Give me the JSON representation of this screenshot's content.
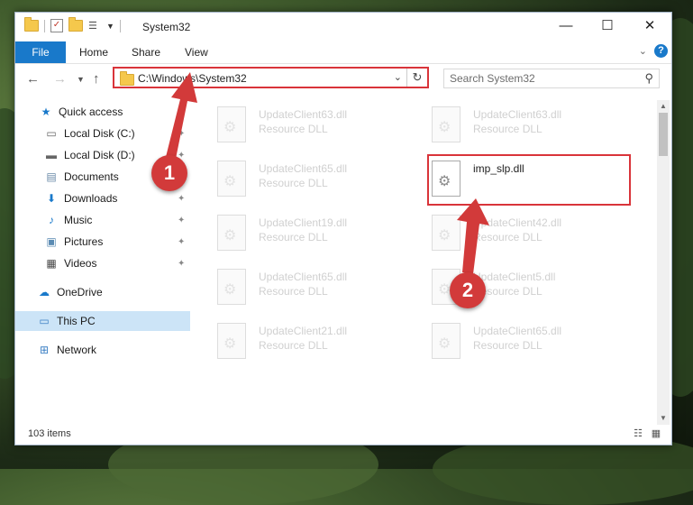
{
  "window": {
    "title": "System32"
  },
  "ribbon": {
    "tabs": [
      "File",
      "Home",
      "Share",
      "View"
    ]
  },
  "address": {
    "path": "C:\\Windows\\System32"
  },
  "search": {
    "placeholder": "Search System32"
  },
  "sidebar": {
    "items": [
      {
        "label": "Quick access",
        "icon": "star-icon",
        "pinned": false
      },
      {
        "label": "Local Disk (C:)",
        "icon": "drive-icon",
        "pinned": true
      },
      {
        "label": "Local Disk (D:)",
        "icon": "drive-icon",
        "pinned": true
      },
      {
        "label": "Documents",
        "icon": "documents-icon",
        "pinned": true
      },
      {
        "label": "Downloads",
        "icon": "downloads-icon",
        "pinned": true
      },
      {
        "label": "Music",
        "icon": "music-icon",
        "pinned": true
      },
      {
        "label": "Pictures",
        "icon": "pictures-icon",
        "pinned": true
      },
      {
        "label": "Videos",
        "icon": "videos-icon",
        "pinned": true
      },
      {
        "label": "OneDrive",
        "icon": "cloud-icon",
        "pinned": false
      },
      {
        "label": "This PC",
        "icon": "computer-icon",
        "pinned": false,
        "selected": true
      },
      {
        "label": "Network",
        "icon": "network-icon",
        "pinned": false
      }
    ]
  },
  "files": [
    {
      "name": "UpdateClient63.dll",
      "type": "Resource DLL"
    },
    {
      "name": "UpdateClient63.dll",
      "type": "Resource DLL"
    },
    {
      "name": "UpdateClient65.dll",
      "type": "Resource DLL"
    },
    {
      "name": "imp_slp.dll",
      "type": ""
    },
    {
      "name": "UpdateClient19.dll",
      "type": "Resource DLL"
    },
    {
      "name": "UpdateClient42.dll",
      "type": "Resource DLL"
    },
    {
      "name": "UpdateClient65.dll",
      "type": "Resource DLL"
    },
    {
      "name": "UpdateClient5.dll",
      "type": "Resource DLL"
    },
    {
      "name": "UpdateClient21.dll",
      "type": "Resource DLL"
    },
    {
      "name": "UpdateClient65.dll",
      "type": "Resource DLL"
    }
  ],
  "status": {
    "item_count": "103 items"
  },
  "callouts": {
    "one": "1",
    "two": "2"
  },
  "colors": {
    "accent": "#1979ca",
    "highlight": "#d9343a",
    "selection": "#cce4f7"
  }
}
